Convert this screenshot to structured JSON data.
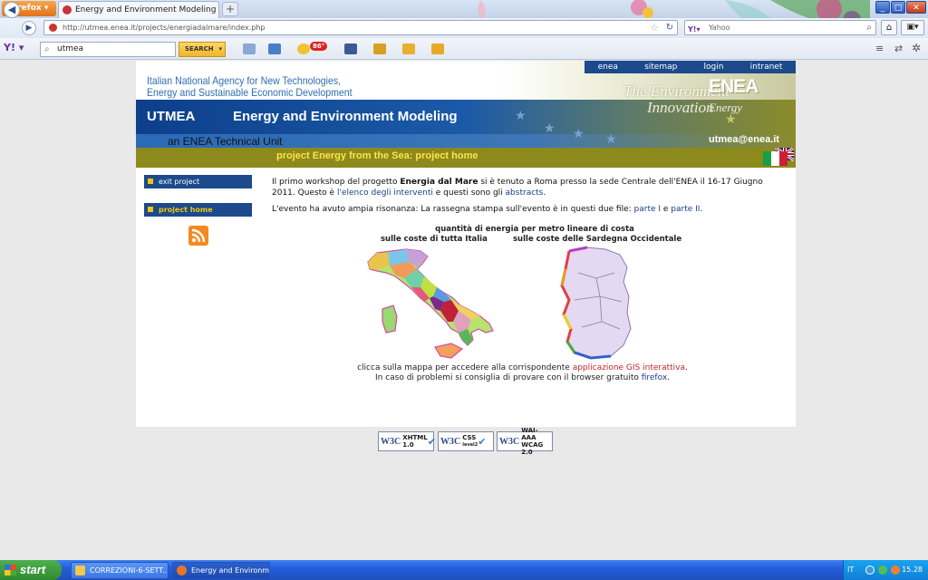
{
  "browser": {
    "app_button": "Firefox",
    "tab_title": "Energy and Environment Modeling",
    "new_tab": "+",
    "url": "http://utmea.enea.it/projects/energiadalmare/index.php",
    "search_engine_placeholder": "Yahoo",
    "window_controls": [
      "minimize",
      "maximize",
      "close"
    ]
  },
  "yahoo_toolbar": {
    "logo": "Y!",
    "query": "utmea",
    "search_button": "SEARCH",
    "weather_badge": "86°"
  },
  "header": {
    "top_nav": [
      "enea",
      "sitemap",
      "login",
      "intranet"
    ],
    "agency_line1": "Italian National Agency for New Technologies,",
    "agency_line2": "Energy and Sustainable Economic Development",
    "unit": "UTMEA",
    "site_title": "Energy and Environment Modeling",
    "subunit": "an ENEA Technical Unit",
    "tagline_1": "The Environment",
    "tagline_2": "Innovation",
    "tagline_3": "Energy",
    "logo_text": "ENEA",
    "email": "utmea@enea.it",
    "page_subtitle": "project Energy from the Sea: project home"
  },
  "sidebar": {
    "items": [
      {
        "label": "exit project"
      },
      {
        "label": "project home"
      }
    ],
    "rss_icon": "rss-icon"
  },
  "content": {
    "p1_a": "Il primo workshop del progetto ",
    "p1_bold": "Energia dal Mare",
    "p1_b": " si è tenuto a Roma presso la sede Centrale dell'ENEA il 16-17 Giugno 2011. Questo è ",
    "p1_link1": "l'elenco degli interventi",
    "p1_c": " e questi sono gli ",
    "p1_link2": "abstracts",
    "p1_d": ".",
    "p2_a": "L'evento ha avuto ampia risonanza: La rassegna stampa sull'evento è in questi due file: ",
    "p2_link1": "parte I",
    "p2_b": " e ",
    "p2_link2": "parte II",
    "p2_c": ".",
    "maps_heading": "quantità di energia per metro lineare di costa",
    "map1_caption": "sulle coste di tutta Italia",
    "map2_caption": "sulle coste delle Sardegna Occidentale",
    "note1_a": "clicca sulla mappa per accedere alla corrispondente ",
    "note1_link": "applicazione GIS interattiva",
    "note1_b": ".",
    "note2_a": "In caso di problemi si consiglia di provare con il browser gratuito ",
    "note2_link": "firefox",
    "note2_b": "."
  },
  "badges": [
    {
      "w3": "W3C",
      "l1": "XHTML",
      "l2": "1.0"
    },
    {
      "w3": "W3C",
      "l1": "CSS",
      "l2": "level2"
    },
    {
      "w3": "W3C",
      "l1": "WAI-AAA",
      "l2": "WCAG 2.0"
    }
  ],
  "taskbar": {
    "start": "start",
    "tasks": [
      "CORREZIONI-6-SETT...",
      "Energy and Environm..."
    ],
    "language": "IT",
    "clock": "15.28"
  },
  "colors": {
    "nav_blue": "#1c4a8c",
    "olive_bar": "#8c8a1c",
    "subtitle_yellow": "#ffe24a",
    "link_red": "#c0262c"
  }
}
